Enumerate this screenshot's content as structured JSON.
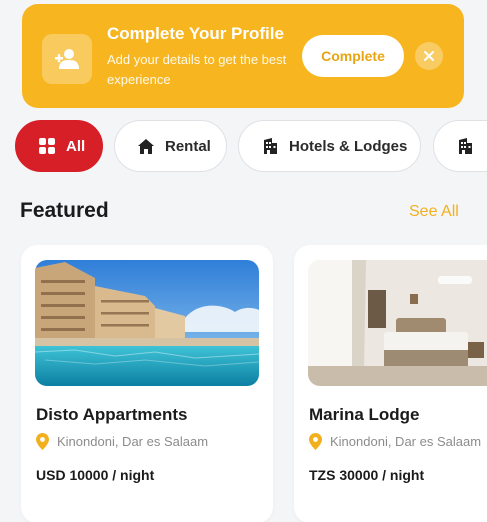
{
  "banner": {
    "icon": "add-user-icon",
    "title": "Complete Your Profile",
    "subtitle": "Add your details to get the best experience",
    "button_label": "Complete",
    "close_icon": "close-icon",
    "color": "#f7b620"
  },
  "categories": [
    {
      "label": "All",
      "icon": "grid-icon",
      "active": true
    },
    {
      "label": "Rental",
      "icon": "home-icon",
      "active": false
    },
    {
      "label": "Hotels & Lodges",
      "icon": "building-icon",
      "active": false
    },
    {
      "label": "",
      "icon": "building-icon",
      "active": false
    }
  ],
  "featured": {
    "title": "Featured",
    "see_all": "See All",
    "items": [
      {
        "name": "Disto Appartments",
        "location": "Kinondoni, Dar es Salaam",
        "price": "USD 10000 / night",
        "icon": "location-pin-icon"
      },
      {
        "name": "Marina Lodge",
        "location": "Kinondoni, Dar es Salaam",
        "price": "TZS 30000 / night",
        "icon": "location-pin-icon"
      }
    ]
  },
  "colors": {
    "accent_red": "#d71f27",
    "accent_yellow": "#f2b01e",
    "background": "#f4f5f7"
  }
}
